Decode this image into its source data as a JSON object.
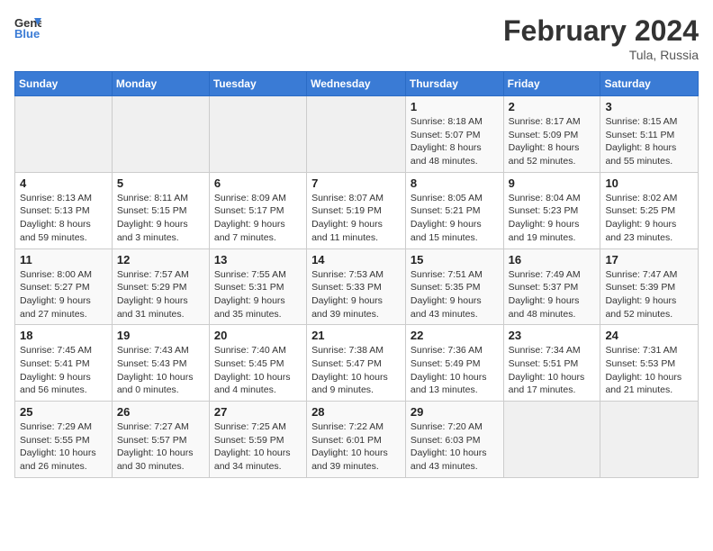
{
  "header": {
    "logo_line1": "General",
    "logo_line2": "Blue",
    "month_year": "February 2024",
    "location": "Tula, Russia"
  },
  "weekdays": [
    "Sunday",
    "Monday",
    "Tuesday",
    "Wednesday",
    "Thursday",
    "Friday",
    "Saturday"
  ],
  "weeks": [
    [
      {
        "day": "",
        "info": ""
      },
      {
        "day": "",
        "info": ""
      },
      {
        "day": "",
        "info": ""
      },
      {
        "day": "",
        "info": ""
      },
      {
        "day": "1",
        "info": "Sunrise: 8:18 AM\nSunset: 5:07 PM\nDaylight: 8 hours\nand 48 minutes."
      },
      {
        "day": "2",
        "info": "Sunrise: 8:17 AM\nSunset: 5:09 PM\nDaylight: 8 hours\nand 52 minutes."
      },
      {
        "day": "3",
        "info": "Sunrise: 8:15 AM\nSunset: 5:11 PM\nDaylight: 8 hours\nand 55 minutes."
      }
    ],
    [
      {
        "day": "4",
        "info": "Sunrise: 8:13 AM\nSunset: 5:13 PM\nDaylight: 8 hours\nand 59 minutes."
      },
      {
        "day": "5",
        "info": "Sunrise: 8:11 AM\nSunset: 5:15 PM\nDaylight: 9 hours\nand 3 minutes."
      },
      {
        "day": "6",
        "info": "Sunrise: 8:09 AM\nSunset: 5:17 PM\nDaylight: 9 hours\nand 7 minutes."
      },
      {
        "day": "7",
        "info": "Sunrise: 8:07 AM\nSunset: 5:19 PM\nDaylight: 9 hours\nand 11 minutes."
      },
      {
        "day": "8",
        "info": "Sunrise: 8:05 AM\nSunset: 5:21 PM\nDaylight: 9 hours\nand 15 minutes."
      },
      {
        "day": "9",
        "info": "Sunrise: 8:04 AM\nSunset: 5:23 PM\nDaylight: 9 hours\nand 19 minutes."
      },
      {
        "day": "10",
        "info": "Sunrise: 8:02 AM\nSunset: 5:25 PM\nDaylight: 9 hours\nand 23 minutes."
      }
    ],
    [
      {
        "day": "11",
        "info": "Sunrise: 8:00 AM\nSunset: 5:27 PM\nDaylight: 9 hours\nand 27 minutes."
      },
      {
        "day": "12",
        "info": "Sunrise: 7:57 AM\nSunset: 5:29 PM\nDaylight: 9 hours\nand 31 minutes."
      },
      {
        "day": "13",
        "info": "Sunrise: 7:55 AM\nSunset: 5:31 PM\nDaylight: 9 hours\nand 35 minutes."
      },
      {
        "day": "14",
        "info": "Sunrise: 7:53 AM\nSunset: 5:33 PM\nDaylight: 9 hours\nand 39 minutes."
      },
      {
        "day": "15",
        "info": "Sunrise: 7:51 AM\nSunset: 5:35 PM\nDaylight: 9 hours\nand 43 minutes."
      },
      {
        "day": "16",
        "info": "Sunrise: 7:49 AM\nSunset: 5:37 PM\nDaylight: 9 hours\nand 48 minutes."
      },
      {
        "day": "17",
        "info": "Sunrise: 7:47 AM\nSunset: 5:39 PM\nDaylight: 9 hours\nand 52 minutes."
      }
    ],
    [
      {
        "day": "18",
        "info": "Sunrise: 7:45 AM\nSunset: 5:41 PM\nDaylight: 9 hours\nand 56 minutes."
      },
      {
        "day": "19",
        "info": "Sunrise: 7:43 AM\nSunset: 5:43 PM\nDaylight: 10 hours\nand 0 minutes."
      },
      {
        "day": "20",
        "info": "Sunrise: 7:40 AM\nSunset: 5:45 PM\nDaylight: 10 hours\nand 4 minutes."
      },
      {
        "day": "21",
        "info": "Sunrise: 7:38 AM\nSunset: 5:47 PM\nDaylight: 10 hours\nand 9 minutes."
      },
      {
        "day": "22",
        "info": "Sunrise: 7:36 AM\nSunset: 5:49 PM\nDaylight: 10 hours\nand 13 minutes."
      },
      {
        "day": "23",
        "info": "Sunrise: 7:34 AM\nSunset: 5:51 PM\nDaylight: 10 hours\nand 17 minutes."
      },
      {
        "day": "24",
        "info": "Sunrise: 7:31 AM\nSunset: 5:53 PM\nDaylight: 10 hours\nand 21 minutes."
      }
    ],
    [
      {
        "day": "25",
        "info": "Sunrise: 7:29 AM\nSunset: 5:55 PM\nDaylight: 10 hours\nand 26 minutes."
      },
      {
        "day": "26",
        "info": "Sunrise: 7:27 AM\nSunset: 5:57 PM\nDaylight: 10 hours\nand 30 minutes."
      },
      {
        "day": "27",
        "info": "Sunrise: 7:25 AM\nSunset: 5:59 PM\nDaylight: 10 hours\nand 34 minutes."
      },
      {
        "day": "28",
        "info": "Sunrise: 7:22 AM\nSunset: 6:01 PM\nDaylight: 10 hours\nand 39 minutes."
      },
      {
        "day": "29",
        "info": "Sunrise: 7:20 AM\nSunset: 6:03 PM\nDaylight: 10 hours\nand 43 minutes."
      },
      {
        "day": "",
        "info": ""
      },
      {
        "day": "",
        "info": ""
      }
    ]
  ]
}
